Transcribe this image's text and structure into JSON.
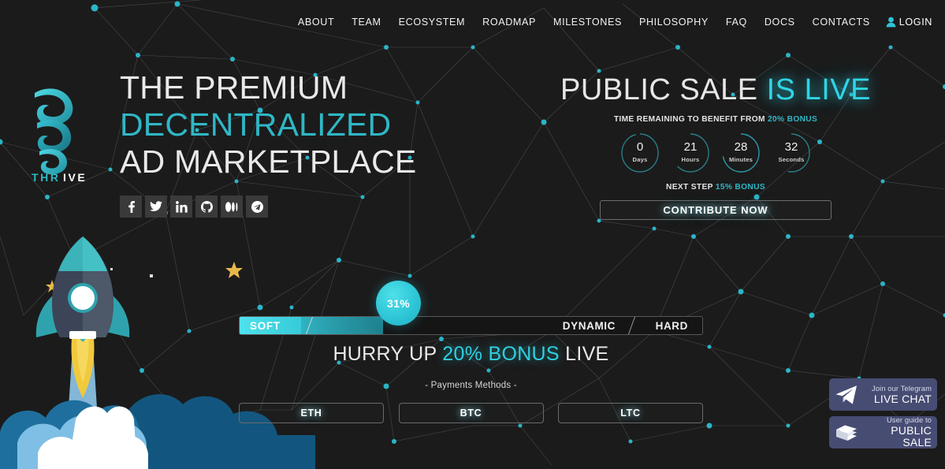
{
  "theme": {
    "background": "#1b1b1b",
    "accent": "#2fb7c6",
    "accent_bright": "#2fd4e6",
    "widget_bg": "#474c73",
    "text": "#e9e9e9",
    "node_color": "#2ab5c8"
  },
  "nav": {
    "items": [
      {
        "label": "ABOUT"
      },
      {
        "label": "TEAM"
      },
      {
        "label": "ECOSYSTEM"
      },
      {
        "label": "ROADMAP"
      },
      {
        "label": "MILESTONES"
      },
      {
        "label": "PHILOSOPHY"
      },
      {
        "label": "FAQ"
      },
      {
        "label": "DOCS"
      },
      {
        "label": "CONTACTS"
      }
    ],
    "login": {
      "label": "LOGIN",
      "icon": "user-icon"
    }
  },
  "logo": {
    "name": "THRIVE",
    "text_accent": "THR",
    "text_plain": "IVE"
  },
  "hero": {
    "line1": "THE PREMIUM",
    "line2": "DECENTRALIZED",
    "line3": "AD MARKETPLACE",
    "socials": [
      {
        "name": "facebook-icon",
        "label": "Facebook"
      },
      {
        "name": "twitter-icon",
        "label": "Twitter"
      },
      {
        "name": "linkedin-icon",
        "label": "LinkedIn"
      },
      {
        "name": "github-icon",
        "label": "GitHub"
      },
      {
        "name": "medium-icon",
        "label": "Medium"
      },
      {
        "name": "telegram-icon",
        "label": "Telegram"
      }
    ]
  },
  "sale": {
    "title_main": "PUBLIC SALE ",
    "title_lit": "IS LIVE",
    "time_remaining_prefix": "TIME REMAINING TO BENEFIT FROM ",
    "time_remaining_bonus": "20% BONUS",
    "countdown": [
      {
        "value": "0",
        "label": "Days",
        "progress": 0.96
      },
      {
        "value": "21",
        "label": "Hours",
        "progress": 0.62
      },
      {
        "value": "28",
        "label": "Minutes",
        "progress": 0.72
      },
      {
        "value": "32",
        "label": "Seconds",
        "progress": 0.53
      }
    ],
    "next_step_prefix": "NEXT STEP ",
    "next_step_bonus": "15% BONUS",
    "contribute_label": "CONTRIBUTE NOW"
  },
  "progress": {
    "percent_label": "31%",
    "percent_value": 31,
    "soft_label": "SOFT",
    "dynamic_label": "DYNAMIC",
    "hard_label": "HARD",
    "hurry_prefix": "HURRY UP ",
    "hurry_bonus": "20% BONUS",
    "hurry_suffix": " LIVE",
    "payments_label": "- Payments Methods -",
    "payment_buttons": [
      {
        "label": "ETH"
      },
      {
        "label": "BTC"
      },
      {
        "label": "LTC"
      }
    ]
  },
  "widgets": [
    {
      "top": "Join our Telegram",
      "bottom": "LIVE CHAT",
      "icon": "telegram-plane-icon"
    },
    {
      "top": "User guide to",
      "bottom": "PUBLIC SALE",
      "icon": "books-icon"
    }
  ]
}
